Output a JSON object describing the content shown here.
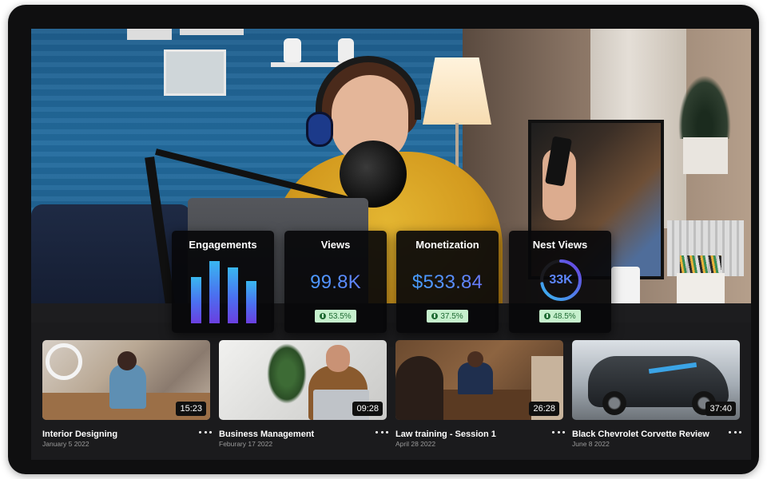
{
  "stats": {
    "engagements": {
      "title": "Engagements",
      "bar_values": [
        0.75,
        1.0,
        0.9,
        0.68
      ]
    },
    "views": {
      "title": "Views",
      "value": "99.8K",
      "change": "53.5%"
    },
    "monetization": {
      "title": "Monetization",
      "value": "$533.84",
      "change": "37.5%"
    },
    "nest_views": {
      "title": "Nest Views",
      "value": "33K",
      "change": "48.5%",
      "ring_fraction": 0.72
    }
  },
  "videos": [
    {
      "title": "Interior Designing",
      "date": "January 5 2022",
      "duration": "15:23"
    },
    {
      "title": "Business Management",
      "date": "Feburary 17 2022",
      "duration": "09:28"
    },
    {
      "title": "Law training - Session 1",
      "date": "April 28 2022",
      "duration": "26:28"
    },
    {
      "title": "Black Chevrolet Corvette Review",
      "date": "June 8 2022",
      "duration": "37:40"
    }
  ],
  "colors": {
    "accent_start": "#39b7f0",
    "accent_end": "#6a3fe0",
    "badge_bg": "#c6f0cd",
    "badge_text": "#1f6b33"
  },
  "icons": {
    "badge": "info-icon",
    "more": "more-dots-icon"
  }
}
